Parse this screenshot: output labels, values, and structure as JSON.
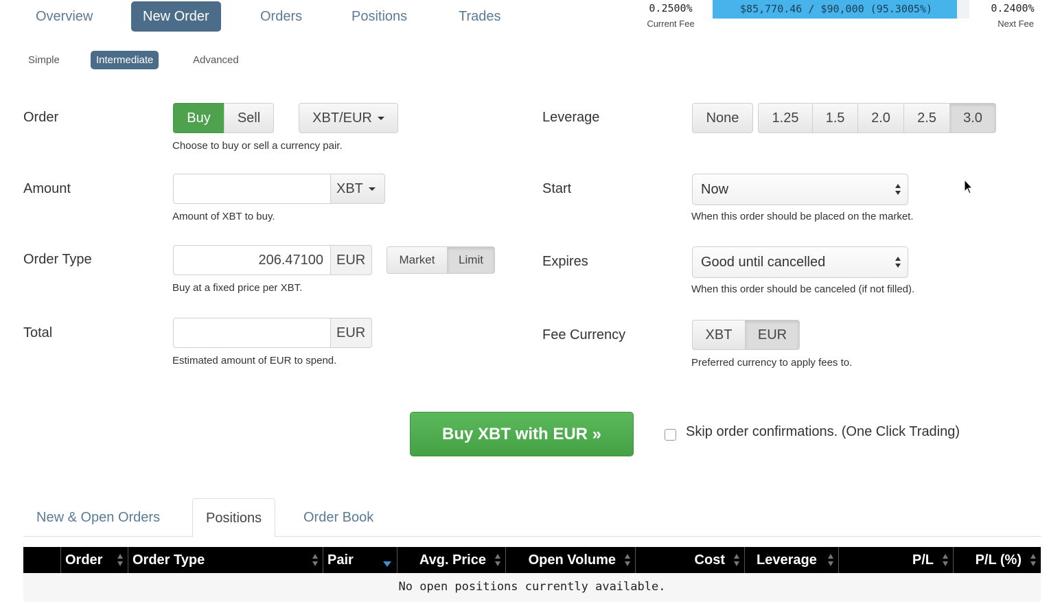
{
  "nav": {
    "tabs": [
      {
        "label": "Overview"
      },
      {
        "label": "New Order"
      },
      {
        "label": "Orders"
      },
      {
        "label": "Positions"
      },
      {
        "label": "Trades"
      }
    ]
  },
  "fees": {
    "current_fee": "0.2500%",
    "current_fee_label": "Current Fee",
    "volume_text": "$85,770.46 / $90,000 (95.3005%)",
    "volume_progress": 0.953,
    "next_fee": "0.2400%",
    "next_fee_label": "Next Fee"
  },
  "mode_tabs": [
    {
      "label": "Simple"
    },
    {
      "label": "Intermediate"
    },
    {
      "label": "Advanced"
    }
  ],
  "form": {
    "order": {
      "label": "Order",
      "buy": "Buy",
      "sell": "Sell",
      "pair": "XBT/EUR",
      "help": "Choose to buy or sell a currency pair."
    },
    "amount": {
      "label": "Amount",
      "value": "",
      "unit": "XBT",
      "help": "Amount of XBT to buy."
    },
    "order_type": {
      "label": "Order Type",
      "price": "206.47100",
      "unit": "EUR",
      "market": "Market",
      "limit": "Limit",
      "help": "Buy at a fixed price per XBT."
    },
    "total": {
      "label": "Total",
      "value": "",
      "unit": "EUR",
      "help": "Estimated amount of EUR to spend."
    },
    "leverage": {
      "label": "Leverage",
      "options": [
        "None",
        "1.25",
        "1.5",
        "2.0",
        "2.5",
        "3.0"
      ],
      "selected": "3.0"
    },
    "start": {
      "label": "Start",
      "value": "Now",
      "help": "When this order should be placed on the market."
    },
    "expires": {
      "label": "Expires",
      "value": "Good until cancelled",
      "help": "When this order should be canceled (if not filled)."
    },
    "fee_currency": {
      "label": "Fee Currency",
      "options": [
        "XBT",
        "EUR"
      ],
      "selected": "EUR",
      "help": "Preferred currency to apply fees to."
    },
    "submit_label": "Buy XBT with EUR »",
    "skip_confirm_label": "Skip order confirmations. (One Click Trading)"
  },
  "bottom_tabs": [
    {
      "label": "New & Open Orders"
    },
    {
      "label": "Positions"
    },
    {
      "label": "Order Book"
    }
  ],
  "table": {
    "columns": [
      "Order",
      "Order Type",
      "Pair",
      "Avg. Price",
      "Open Volume",
      "Cost",
      "Leverage",
      "P/L",
      "P/L (%)"
    ],
    "empty_message": "No open positions currently available."
  },
  "colors": {
    "accent": "#4c6d8a",
    "buy_green": "#4ea24e",
    "progress_blue": "#46b4ea"
  }
}
